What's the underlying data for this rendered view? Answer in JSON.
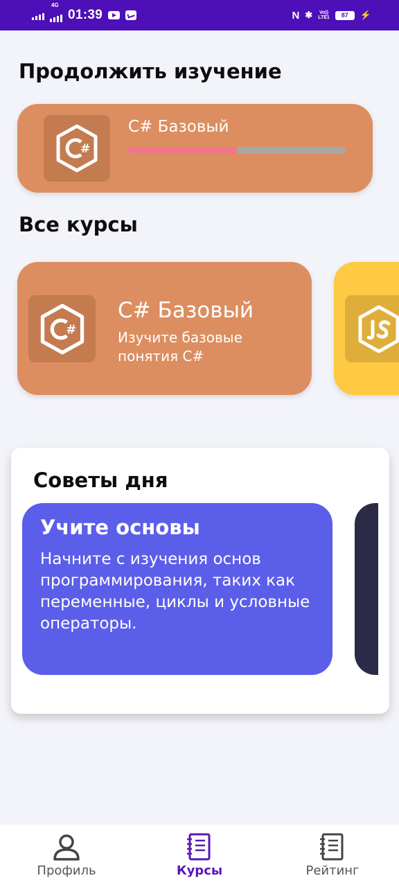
{
  "status_bar": {
    "time": "01:39",
    "network_tag": "4G",
    "lte_line1": "Vo))",
    "lte_line2": "LTE1",
    "battery": "87",
    "nfc_glyph": "N",
    "bt_glyph": "✱",
    "charging_glyph": "⚡"
  },
  "continue_section": {
    "heading": "Продолжить изучение",
    "course": {
      "title": "C# Базовый",
      "icon": "csharp-icon",
      "progress_percent": 50
    }
  },
  "courses_section": {
    "heading": "Все курсы",
    "courses": [
      {
        "title": "C# Базовый",
        "description": "Изучите базовые понятия C#",
        "icon": "csharp-icon",
        "color": "#dc8e60"
      },
      {
        "icon": "nodejs-icon",
        "color": "#fec943"
      }
    ]
  },
  "tips_section": {
    "heading": "Советы дня",
    "tips": [
      {
        "title": "Учите основы",
        "text": "Начните с изучения основ программирования, таких как переменные, циклы и условные операторы.",
        "color": "#5b5ee9"
      },
      {
        "color": "#2b2a47"
      }
    ]
  },
  "bottom_nav": {
    "items": [
      {
        "label": "Профиль",
        "icon": "profile-icon"
      },
      {
        "label": "Курсы",
        "icon": "courses-icon",
        "active": true
      },
      {
        "label": "Рейтинг",
        "icon": "rating-icon"
      }
    ]
  },
  "colors": {
    "accent": "#5a16b7",
    "status_bar": "#4d0fb8"
  }
}
